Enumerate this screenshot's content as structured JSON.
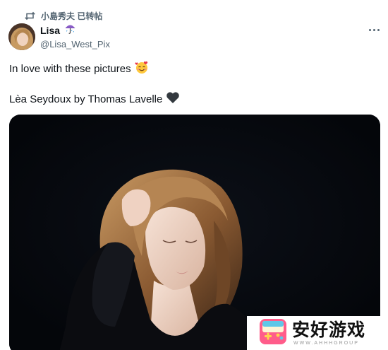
{
  "repost": {
    "text": "小島秀夫 已转帖",
    "icon": "retweet-icon"
  },
  "author": {
    "display_name": "Lisa",
    "name_emoji": "umbrella-icon",
    "handle": "@Lisa_West_Pix",
    "avatar": "avatar"
  },
  "more_icon": "more-icon",
  "tweet": {
    "line1": "In love with these pictures",
    "line1_emoji": "smiling-face-with-hearts-icon",
    "line2": "Lèa Seydoux by Thomas Lavelle",
    "line2_emoji": "black-heart-icon"
  },
  "media": {
    "kind": "photo",
    "background": "#06080e"
  },
  "watermark": {
    "title": "安好游戏",
    "subtitle": "WWW.AHHHGROUP",
    "logo": "gamepad-logo-icon"
  },
  "colors": {
    "text_primary": "#0f1419",
    "text_secondary": "#536471",
    "media_bg": "#06080e"
  }
}
